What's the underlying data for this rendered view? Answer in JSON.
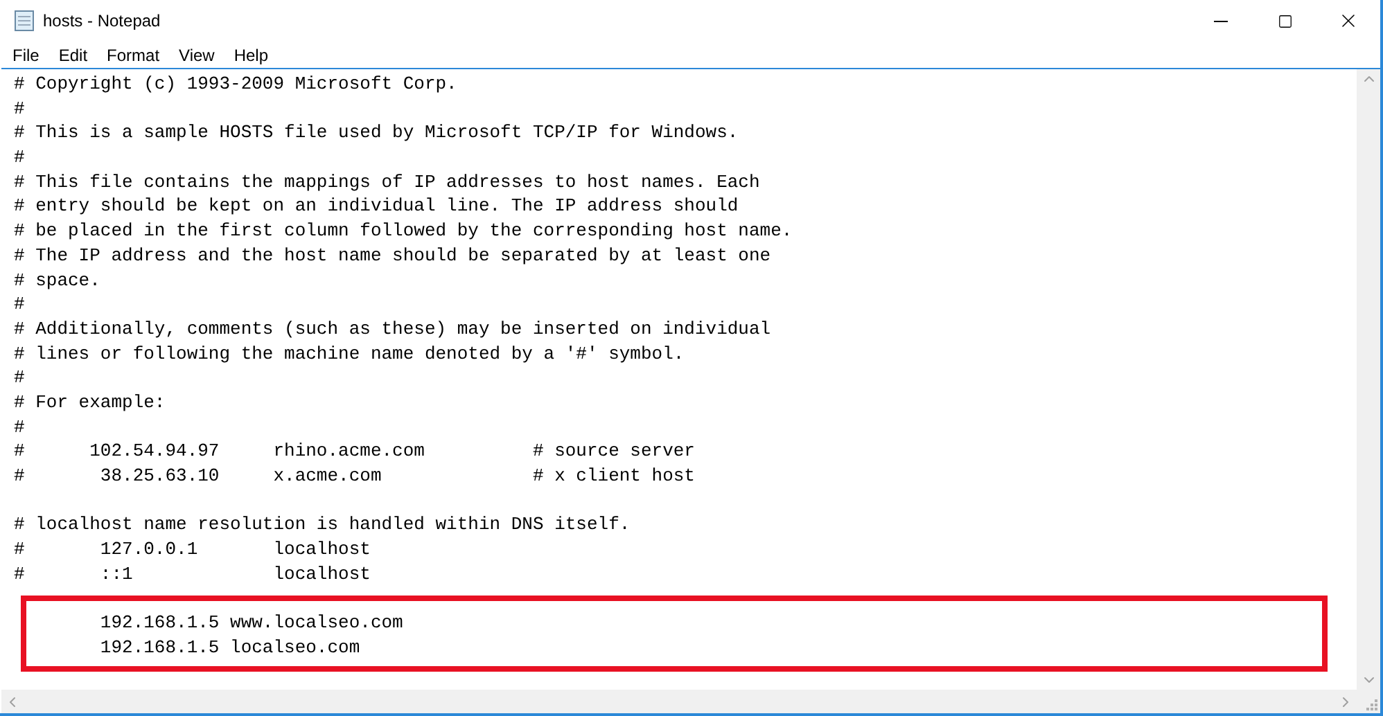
{
  "window": {
    "title": "hosts - Notepad"
  },
  "menu": [
    {
      "label": "File"
    },
    {
      "label": "Edit"
    },
    {
      "label": "Format"
    },
    {
      "label": "View"
    },
    {
      "label": "Help"
    }
  ],
  "editor": {
    "lines": [
      {
        "kind": "text",
        "text": "# Copyright (c) 1993-2009 Microsoft Corp."
      },
      {
        "kind": "text",
        "text": "#"
      },
      {
        "kind": "text",
        "text": "# This is a sample HOSTS file used by Microsoft TCP/IP for Windows."
      },
      {
        "kind": "text",
        "text": "#"
      },
      {
        "kind": "text",
        "text": "# This file contains the mappings of IP addresses to host names. Each"
      },
      {
        "kind": "text",
        "text": "# entry should be kept on an individual line. The IP address should"
      },
      {
        "kind": "text",
        "text": "# be placed in the first column followed by the corresponding host name."
      },
      {
        "kind": "text",
        "text": "# The IP address and the host name should be separated by at least one"
      },
      {
        "kind": "text",
        "text": "# space."
      },
      {
        "kind": "text",
        "text": "#"
      },
      {
        "kind": "text",
        "text": "# Additionally, comments (such as these) may be inserted on individual"
      },
      {
        "kind": "text",
        "text": "# lines or following the machine name denoted by a '#' symbol."
      },
      {
        "kind": "text",
        "text": "#"
      },
      {
        "kind": "text",
        "text": "# For example:"
      },
      {
        "kind": "text",
        "text": "#"
      },
      {
        "kind": "text",
        "text": "#      102.54.94.97     rhino.acme.com          # source server"
      },
      {
        "kind": "text",
        "text": "#       38.25.63.10     x.acme.com              # x client host"
      },
      {
        "kind": "blank"
      },
      {
        "kind": "text",
        "text": "# localhost name resolution is handled within DNS itself."
      },
      {
        "kind": "text",
        "text": "#       127.0.0.1       localhost"
      },
      {
        "kind": "text",
        "text": "#       ::1             localhost"
      },
      {
        "kind": "blank",
        "highlighted": true
      },
      {
        "kind": "text",
        "text": "        192.168.1.5 www.localseo.com",
        "highlighted": true
      },
      {
        "kind": "text",
        "text": "        192.168.1.5 localseo.com",
        "highlighted": true
      }
    ]
  }
}
